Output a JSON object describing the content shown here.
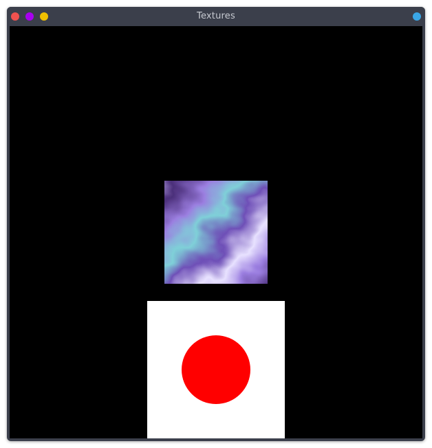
{
  "window": {
    "title": "Textures",
    "controls": {
      "close": {
        "icon": "close-dot-icon",
        "color": "#f0524f"
      },
      "minimize": {
        "icon": "minimize-dot-icon",
        "color": "#a800f0"
      },
      "maximize": {
        "icon": "maximize-dot-icon",
        "color": "#f0c000"
      },
      "extra": {
        "icon": "menu-dot-icon",
        "color": "#3aa6e6"
      }
    },
    "frame_color": "#3b3f4b",
    "title_color": "#c8cbd2"
  },
  "scene": {
    "background": "#000000",
    "texture_quad": {
      "description_icon": "marble-texture-image",
      "palette": [
        "#6e4fb7",
        "#9b7ee0",
        "#c3b2f3",
        "#7fd0d8",
        "#4b2f7a",
        "#e8e2ff"
      ]
    },
    "sprite_quad": {
      "background": "#ffffff",
      "circle_color": "#ff0000"
    }
  }
}
